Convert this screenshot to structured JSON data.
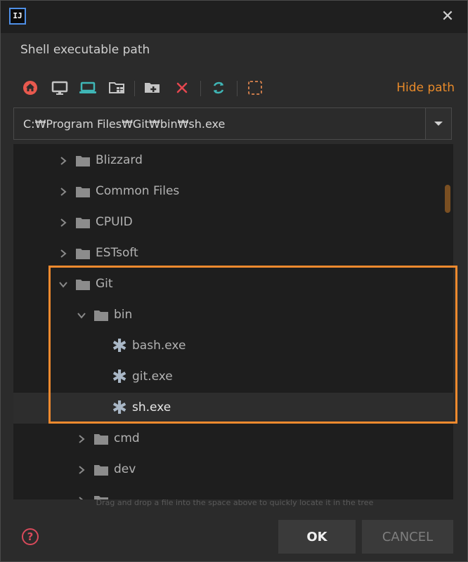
{
  "window": {
    "app_logo_text": "IJ",
    "close_glyph": "✕"
  },
  "dialog": {
    "title": "Shell executable path",
    "hide_path_label": "Hide path"
  },
  "toolbar": {
    "buttons": [
      {
        "name": "home-icon",
        "color": "#e8594e"
      },
      {
        "name": "desktop-icon",
        "color": "#c4c4c4"
      },
      {
        "name": "laptop-icon",
        "color": "#3fb6b6"
      },
      {
        "name": "module-folder-icon",
        "color": "#c4c4c4"
      },
      {
        "name": "new-folder-icon",
        "color": "#c4c4c4"
      },
      {
        "name": "delete-icon",
        "color": "#e5474f"
      },
      {
        "name": "refresh-icon",
        "color": "#3fb6b6"
      },
      {
        "name": "select-area-icon",
        "color": "#c87a4a"
      }
    ]
  },
  "path": {
    "value": "C:₩Program Files₩Git₩bin₩sh.exe"
  },
  "tree": {
    "items": [
      {
        "label": "Blizzard",
        "level": 1,
        "type": "folder",
        "expanded": false
      },
      {
        "label": "Common Files",
        "level": 1,
        "type": "folder",
        "expanded": false
      },
      {
        "label": "CPUID",
        "level": 1,
        "type": "folder",
        "expanded": false
      },
      {
        "label": "ESTsoft",
        "level": 1,
        "type": "folder",
        "expanded": false
      },
      {
        "label": "Git",
        "level": 1,
        "type": "folder",
        "expanded": true
      },
      {
        "label": "bin",
        "level": 2,
        "type": "folder",
        "expanded": true
      },
      {
        "label": "bash.exe",
        "level": 3,
        "type": "file"
      },
      {
        "label": "git.exe",
        "level": 3,
        "type": "file"
      },
      {
        "label": "sh.exe",
        "level": 3,
        "type": "file",
        "selected": true
      },
      {
        "label": "cmd",
        "level": 2,
        "type": "folder",
        "expanded": false
      },
      {
        "label": "dev",
        "level": 2,
        "type": "folder",
        "expanded": false
      },
      {
        "label": "",
        "level": 2,
        "type": "folder",
        "expanded": false
      }
    ]
  },
  "hint": "Drag and drop a file into the space above to quickly locate it in the tree",
  "help_label": "?",
  "buttons": {
    "ok": "OK",
    "cancel": "CANCEL"
  },
  "colors": {
    "accent": "#e88a2a",
    "highlight_border": "#f08a2e",
    "folder": "#8c8c8c",
    "file_icon": "#a9b7c6"
  }
}
